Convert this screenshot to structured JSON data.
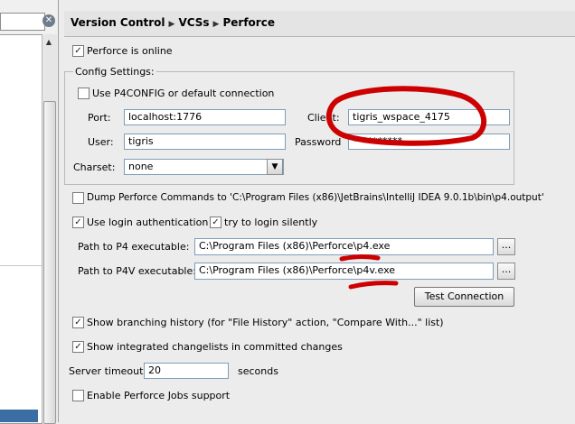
{
  "breadcrumb": [
    "Version Control",
    "VCSs",
    "Perforce"
  ],
  "left_pane": {
    "clear_icon": "clear-search-icon"
  },
  "online": {
    "label": "Perforce is online",
    "checked": true
  },
  "config": {
    "title": "Config Settings:",
    "p4config_label": "Use P4CONFIG or default connection",
    "port_label": "Port:",
    "port_value": "localhost:1776",
    "client_label": "Client:",
    "client_value": "tigris_wspace_4175",
    "user_label": "User:",
    "user_value": "tigris",
    "password_label": "Password",
    "password_value": "**********",
    "charset_label": "Charset:",
    "charset_value": "none"
  },
  "dump": {
    "label": "Dump Perforce Commands to  'C:\\Program Files (x86)\\JetBrains\\IntelliJ IDEA 9.0.1b\\bin\\p4.output'"
  },
  "login_auth": {
    "label": "Use login authentication",
    "checked": true
  },
  "login_silent": {
    "label": "try to login silently",
    "checked": true
  },
  "p4_path": {
    "label": "Path to P4 executable:",
    "value": "C:\\Program Files (x86)\\Perforce\\p4.exe",
    "browse": "..."
  },
  "p4v_path": {
    "label": "Path to P4V executable:",
    "value": "C:\\Program Files (x86)\\Perforce\\p4v.exe",
    "browse": "..."
  },
  "test_button": "Test Connection",
  "branching": {
    "label": "Show branching history (for \"File History\" action, \"Compare With...\" list)",
    "checked": true
  },
  "integrated": {
    "label": "Show integrated changelists in committed changes",
    "checked": true
  },
  "timeout": {
    "label": "Server timeout",
    "value": "20",
    "unit": "seconds"
  },
  "jobs": {
    "label": "Enable Perforce Jobs support",
    "checked": false
  },
  "colors": {
    "annotation": "#cc0000",
    "selection": "#3a6ea5"
  }
}
